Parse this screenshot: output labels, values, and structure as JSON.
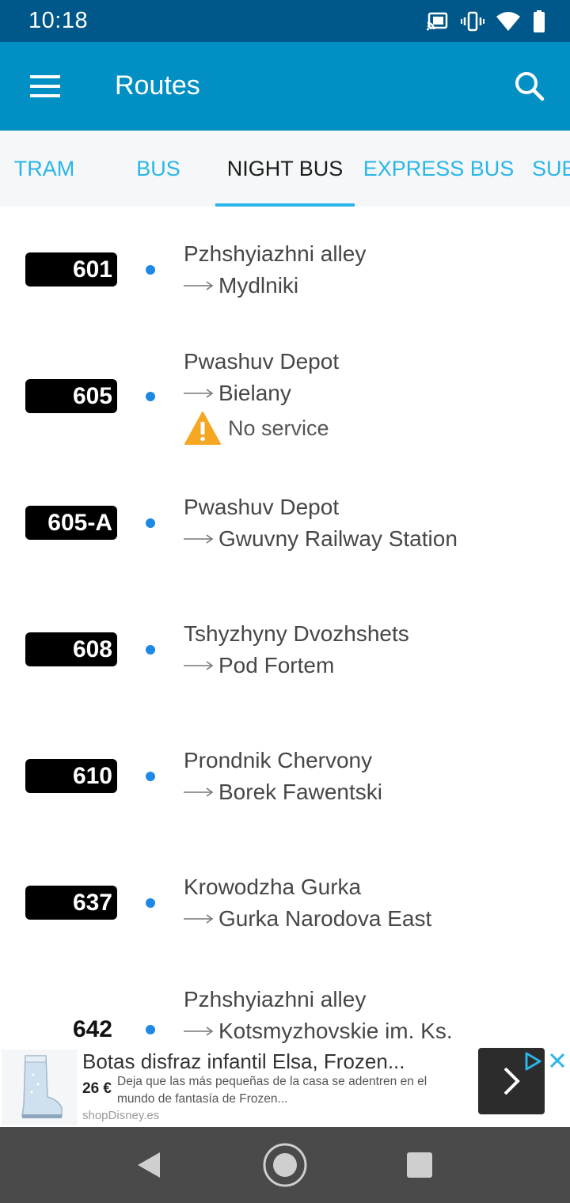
{
  "status_bar": {
    "time": "10:18",
    "icons": [
      "cast-icon",
      "vibrate-icon",
      "wifi-icon",
      "battery-icon"
    ]
  },
  "app_bar": {
    "title": "Routes",
    "menu_icon": "menu-icon",
    "search_icon": "search-icon",
    "color": "#0290c4"
  },
  "tabs": [
    {
      "label": "TRAM",
      "active": false
    },
    {
      "label": "BUS",
      "active": false
    },
    {
      "label": "NIGHT BUS",
      "active": true
    },
    {
      "label": "EXPRESS BUS",
      "active": false
    },
    {
      "label": "SUB",
      "active": false
    }
  ],
  "routes": [
    {
      "number": "601",
      "from": "Pzhshyiazhni alley",
      "to": "Mydlniki"
    },
    {
      "number": "605",
      "from": "Pwashuv Depot",
      "to": "Bielany",
      "warning": "No service"
    },
    {
      "number": "605-A",
      "from": "Pwashuv Depot",
      "to": "Gwuvny Railway Station"
    },
    {
      "number": "608",
      "from": "Tshyzhyny Dvozhshets",
      "to": "Pod Fortem"
    },
    {
      "number": "610",
      "from": "Prondnik Chervony",
      "to": "Borek Fawentski"
    },
    {
      "number": "637",
      "from": "Krowodzha Gurka",
      "to": "Gurka Narodova East"
    },
    {
      "number": "642",
      "from": "Pzhshyiazhni alley",
      "to": "Kotsmyzhovskie im. Ks."
    }
  ],
  "ad": {
    "title": "Botas disfraz infantil Elsa, Frozen...",
    "price": "26 €",
    "description": "Deja que las más pequeñas de la casa se adentren en el mundo de fantasía de Frozen...",
    "domain": "shopDisney.es"
  },
  "colors": {
    "accent": "#29b6e8",
    "dot": "#1e88e5",
    "warning": "#f5a623"
  }
}
